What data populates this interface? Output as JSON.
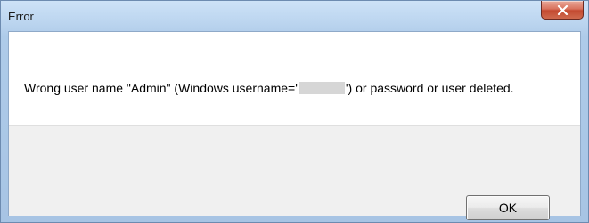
{
  "window": {
    "title": "Error"
  },
  "dialog": {
    "message_before": "Wrong user name \"Admin\" (Windows username='",
    "message_after": "') or password or user deleted.",
    "ok_label": "OK"
  },
  "icons": {
    "close": "close-icon"
  },
  "colors": {
    "close_button": "#c34a31",
    "frame": "#aecbe9",
    "footer": "#f0f0f0"
  }
}
